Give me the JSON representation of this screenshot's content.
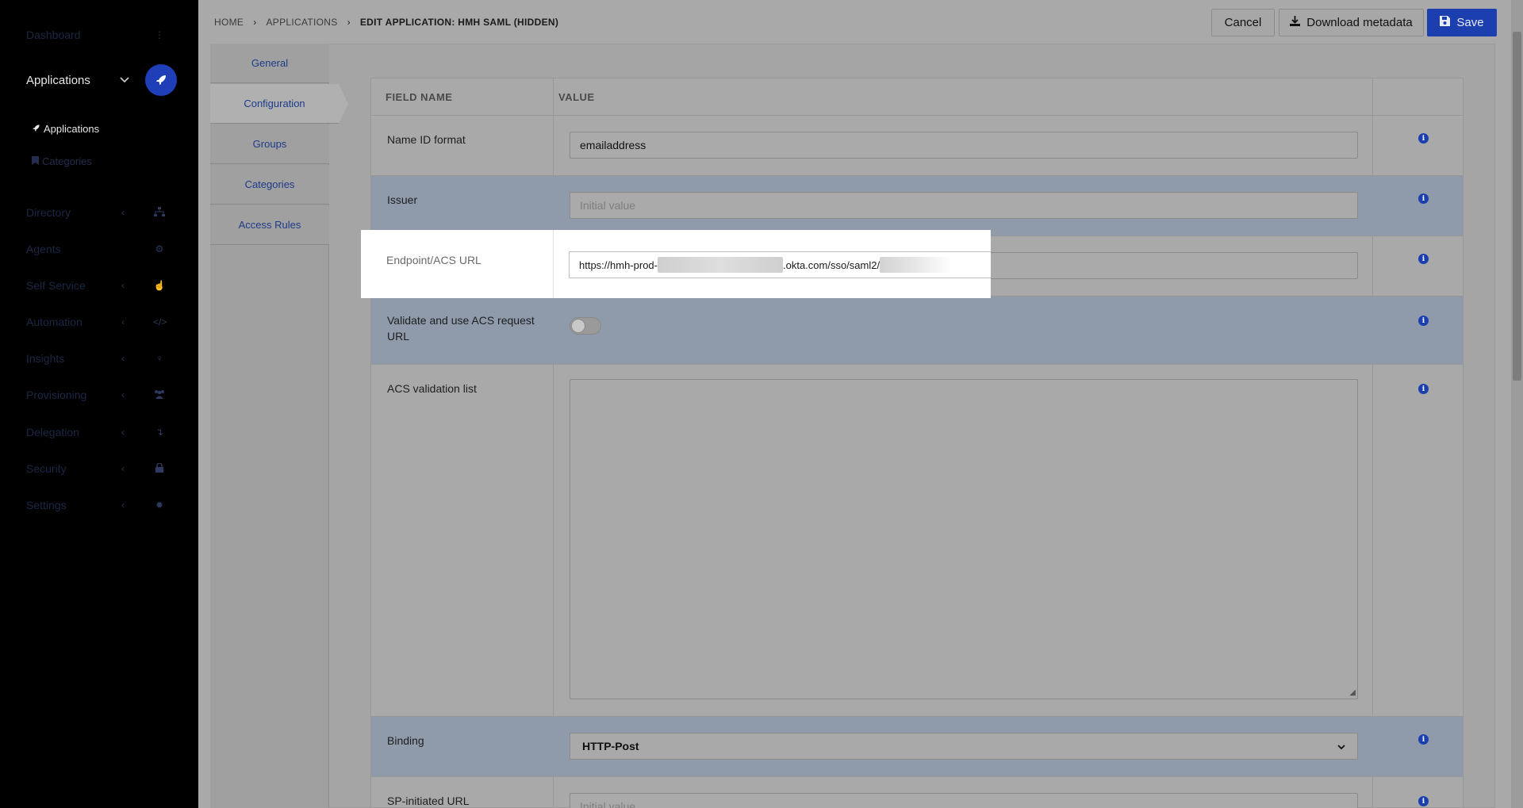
{
  "sidebar": {
    "items": [
      {
        "label": "Dashboard",
        "chevron": "",
        "icon": "dashboard-icon"
      },
      {
        "label": "Applications",
        "chevron": "⌄",
        "icon": "rocket-icon"
      },
      {
        "label": "Directory",
        "chevron": "‹",
        "icon": "directory-icon"
      },
      {
        "label": "Agents",
        "chevron": "",
        "icon": "agents-icon"
      },
      {
        "label": "Self Service",
        "chevron": "‹",
        "icon": "self-service-icon"
      },
      {
        "label": "Automation",
        "chevron": "‹",
        "icon": "code-icon"
      },
      {
        "label": "Insights",
        "chevron": "‹",
        "icon": "lightbulb-icon"
      },
      {
        "label": "Provisioning",
        "chevron": "‹",
        "icon": "users-icon"
      },
      {
        "label": "Delegation",
        "chevron": "‹",
        "icon": "delegation-icon"
      },
      {
        "label": "Security",
        "chevron": "‹",
        "icon": "lock-icon"
      },
      {
        "label": "Settings",
        "chevron": "‹",
        "icon": "gear-icon"
      }
    ],
    "subitems": [
      {
        "label": "Applications",
        "icon": "rocket-icon"
      },
      {
        "label": "Categories",
        "icon": "bookmark-icon"
      }
    ]
  },
  "breadcrumb": {
    "home": "HOME",
    "applications": "APPLICATIONS",
    "current": "EDIT APPLICATION: HMH SAML (HIDDEN)"
  },
  "toolbar": {
    "cancel_label": "Cancel",
    "download_label": "Download metadata",
    "save_label": "Save"
  },
  "tabs": [
    "General",
    "Configuration",
    "Groups",
    "Categories",
    "Access Rules"
  ],
  "active_tab": "Configuration",
  "table": {
    "col_field": "FIELD NAME",
    "col_value": "VALUE",
    "rows": {
      "name_id_format": {
        "label": "Name ID format",
        "value": "emailaddress"
      },
      "issuer": {
        "label": "Issuer",
        "placeholder": "Initial value"
      },
      "endpoint": {
        "label": "Endpoint/ACS URL",
        "value_prefix": "https://hmh-prod-",
        "value_middle": ".okta.com/sso/saml2/"
      },
      "validate": {
        "label": "Validate and use ACS request URL",
        "enabled": false
      },
      "acs_list": {
        "label": "ACS validation list"
      },
      "binding": {
        "label": "Binding",
        "value": "HTTP-Post"
      },
      "sp_initiated": {
        "label": "SP-initiated URL",
        "placeholder": "Initial value"
      }
    }
  },
  "colors": {
    "accent": "#1c3fb0",
    "highlight_row": "#8f9aab"
  }
}
